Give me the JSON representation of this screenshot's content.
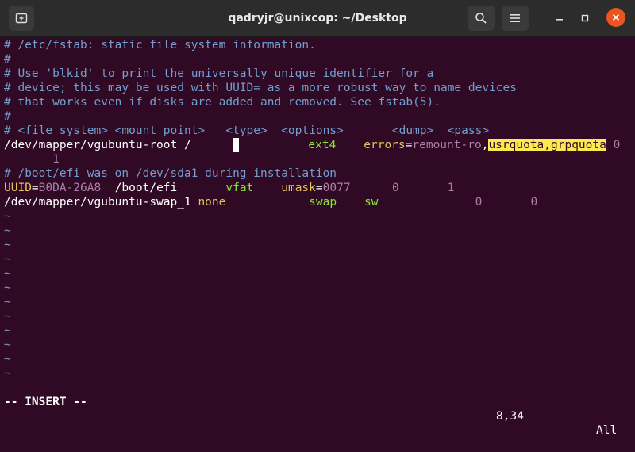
{
  "window": {
    "title": "qadryjr@unixcop: ~/Desktop",
    "icons": {
      "new_tab": "new-tab-icon",
      "search": "search-icon",
      "menu": "hamburger-menu-icon",
      "minimize": "minimize-icon",
      "maximize": "maximize-icon",
      "close": "close-icon"
    }
  },
  "editor": {
    "line1": "# /etc/fstab: static file system information.",
    "line2": "#",
    "line3": "# Use 'blkid' to print the universally unique identifier for a",
    "line4": "# device; this may be used with UUID= as a more robust way to name devices",
    "line5": "# that works even if disks are added and removed. See fstab(5).",
    "line6": "#",
    "line7": "# <file system> <mount point>   <type>  <options>       <dump>  <pass>",
    "root": {
      "device": "/dev/mapper/vgubuntu-root",
      "mount": "/",
      "type": "ext4",
      "opt_errors": "errors",
      "opt_eq": "=",
      "opt_remount": "remount-ro",
      "opt_comma": ",",
      "opt_quota": "usrquota,grpquota",
      "dump": "0",
      "pass": "1"
    },
    "comment_boot": "# /boot/efi was on /dev/sda1 during installation",
    "efi": {
      "uuid_key": "UUID",
      "uuid_eq": "=",
      "uuid_val": "B0DA-26A8",
      "mount": "/boot/efi",
      "type": "vfat",
      "umask_key": "umask",
      "umask_eq": "=",
      "umask_val": "0077",
      "dump": "0",
      "pass": "1"
    },
    "swap": {
      "device": "/dev/mapper/vgubuntu-swap_1",
      "mount": "none",
      "type": "swap",
      "options": "sw",
      "dump": "0",
      "pass": "0"
    },
    "tilde": "~"
  },
  "status": {
    "mode": "-- INSERT --",
    "position": "8,34",
    "scroll": "All"
  },
  "colors": {
    "background": "#300a24",
    "comment": "#729fcf",
    "highlight": "#fce94f",
    "close_button": "#e95420"
  }
}
